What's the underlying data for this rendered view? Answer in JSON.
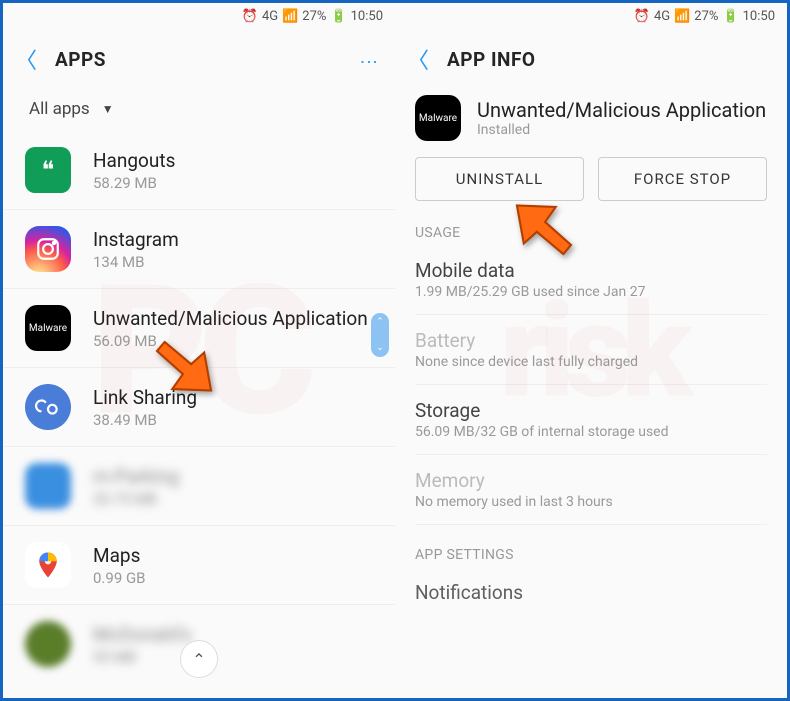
{
  "status_bar": {
    "network": "4G",
    "battery_pct": "27%",
    "time": "10:50"
  },
  "left": {
    "title": "APPS",
    "filter": "All apps",
    "apps": [
      {
        "name": "Hangouts",
        "sub": "58.29 MB"
      },
      {
        "name": "Instagram",
        "sub": "134 MB"
      },
      {
        "name": "Unwanted/Malicious Application",
        "sub": "56.09 MB"
      },
      {
        "name": "Link Sharing",
        "sub": "38.49 MB"
      },
      {
        "name": "m-Parking",
        "sub": "20.75 MB"
      },
      {
        "name": "Maps",
        "sub": "0.99 GB"
      },
      {
        "name": "McDonald's",
        "sub": "55 MB"
      }
    ]
  },
  "right": {
    "title": "APP INFO",
    "app_name": "Unwanted/Malicious Application",
    "app_status": "Installed",
    "icon_label": "Malware",
    "uninstall": "UNINSTALL",
    "force_stop": "FORCE STOP",
    "usage_label": "USAGE",
    "mobile_data": {
      "title": "Mobile data",
      "sub": "1.99 MB/25.29 GB used since Jan 27"
    },
    "battery": {
      "title": "Battery",
      "sub": "None since device last fully charged"
    },
    "storage": {
      "title": "Storage",
      "sub": "56.09 MB/32 GB of internal storage used"
    },
    "memory": {
      "title": "Memory",
      "sub": "No memory used in last 3 hours"
    },
    "app_settings_label": "APP SETTINGS",
    "notifications": "Notifications"
  }
}
